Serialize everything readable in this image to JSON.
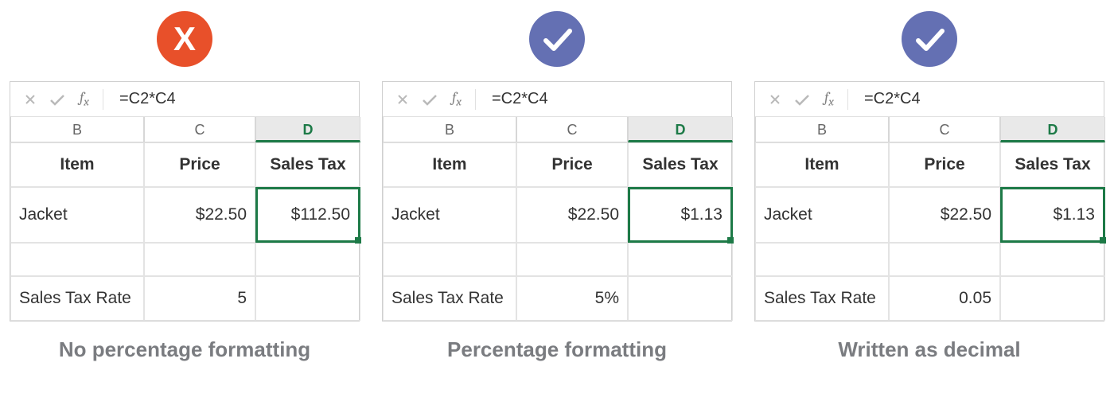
{
  "badges": {
    "x_glyph": "X"
  },
  "formula": "=C2*C4",
  "columns": {
    "b": "B",
    "c": "C",
    "d": "D"
  },
  "headers": {
    "item": "Item",
    "price": "Price",
    "tax": "Sales Tax"
  },
  "rowLabels": {
    "item": "Jacket",
    "rate": "Sales Tax Rate"
  },
  "price": "$22.50",
  "panels": [
    {
      "badge": "x",
      "tax": "$112.50",
      "rate": "5",
      "caption": "No percentage formatting"
    },
    {
      "badge": "check",
      "tax": "$1.13",
      "rate": "5%",
      "caption": "Percentage formatting"
    },
    {
      "badge": "check",
      "tax": "$1.13",
      "rate": "0.05",
      "caption": "Written as decimal"
    }
  ]
}
